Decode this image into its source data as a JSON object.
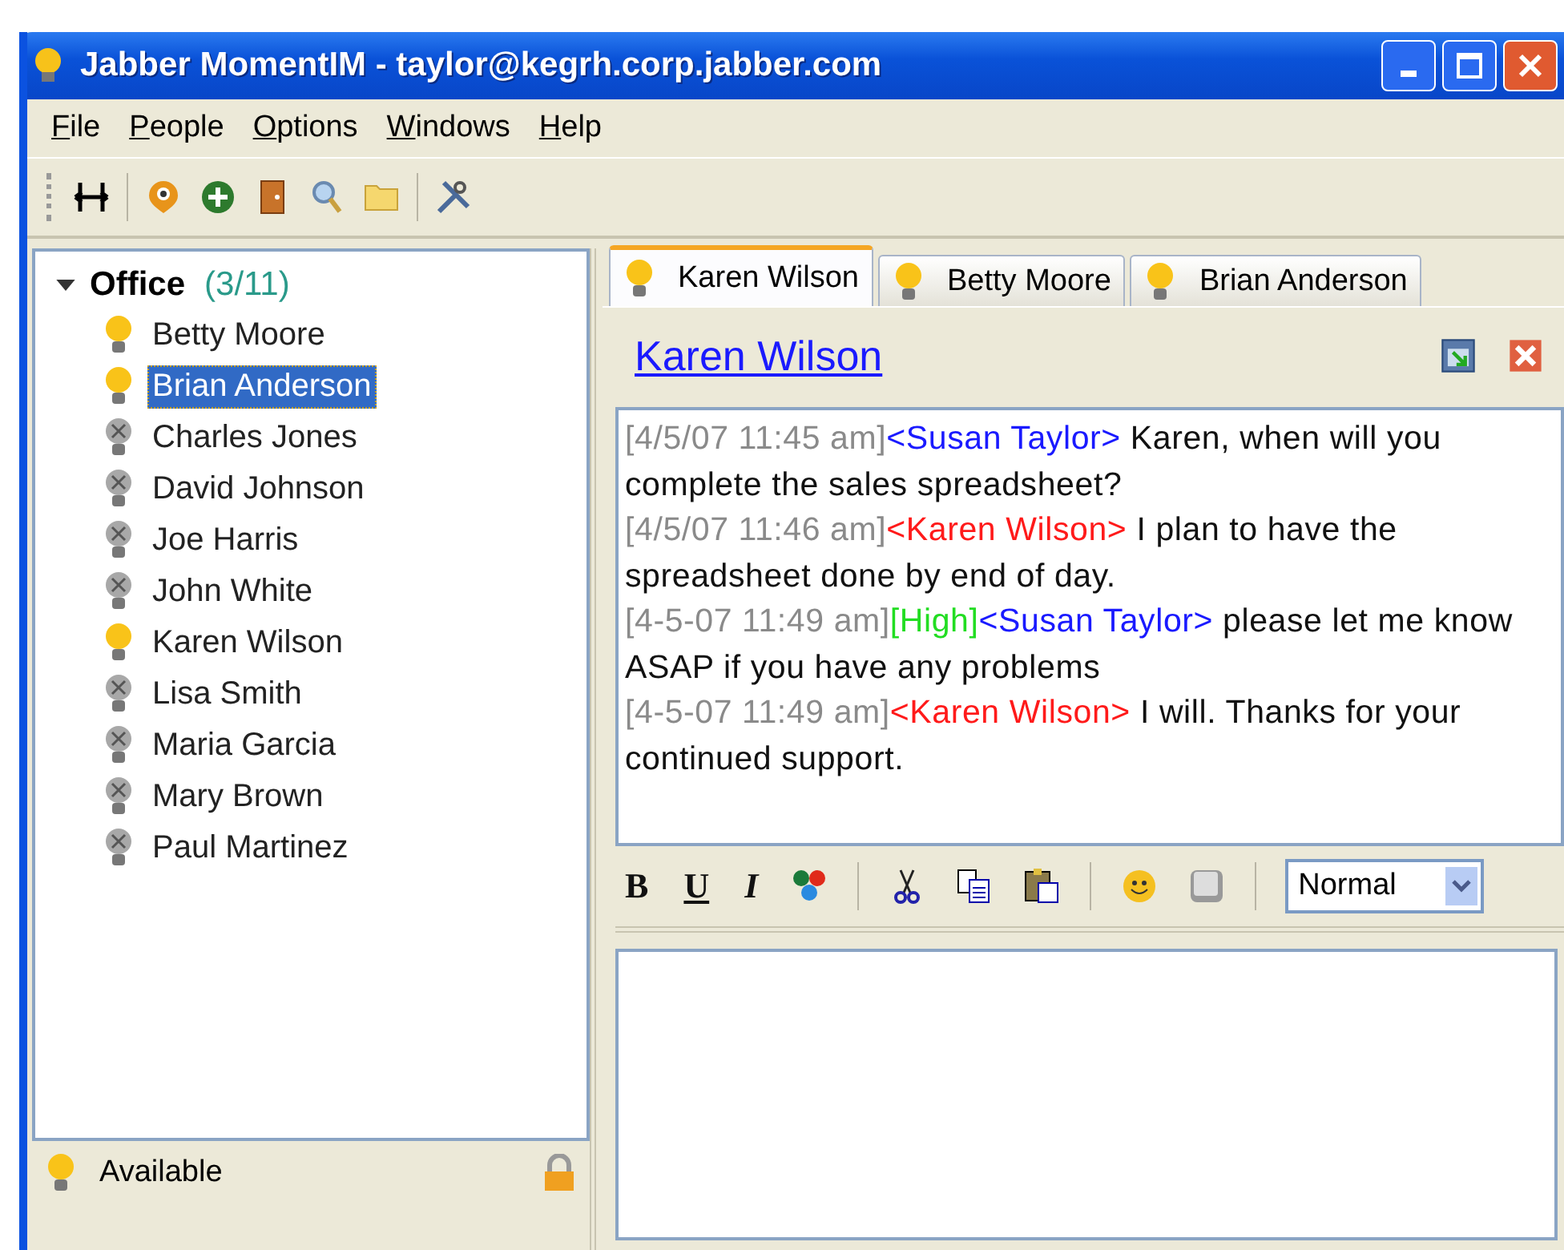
{
  "window": {
    "title": "Jabber MomentIM - taylor@kegrh.corp.jabber.com"
  },
  "menu": [
    "File",
    "People",
    "Options",
    "Windows",
    "Help"
  ],
  "roster": {
    "group": {
      "name": "Office",
      "count": "(3/11)",
      "expanded": true
    },
    "contacts": [
      {
        "name": "Betty Moore",
        "online": true,
        "selected": false
      },
      {
        "name": "Brian Anderson",
        "online": true,
        "selected": true
      },
      {
        "name": "Charles Jones",
        "online": false,
        "selected": false
      },
      {
        "name": "David Johnson",
        "online": false,
        "selected": false
      },
      {
        "name": "Joe Harris",
        "online": false,
        "selected": false
      },
      {
        "name": "John White",
        "online": false,
        "selected": false
      },
      {
        "name": "Karen Wilson",
        "online": true,
        "selected": false
      },
      {
        "name": "Lisa Smith",
        "online": false,
        "selected": false
      },
      {
        "name": "Maria Garcia",
        "online": false,
        "selected": false
      },
      {
        "name": "Mary Brown",
        "online": false,
        "selected": false
      },
      {
        "name": "Paul Martinez",
        "online": false,
        "selected": false
      }
    ]
  },
  "status": {
    "label": "Available"
  },
  "tabs": [
    {
      "label": "Karen Wilson",
      "selected": true
    },
    {
      "label": "Betty Moore",
      "selected": false
    },
    {
      "label": "Brian Anderson",
      "selected": false
    }
  ],
  "chat": {
    "contact": "Karen Wilson",
    "messages": [
      {
        "time": "[4/5/07 11:45 am]",
        "sender": "<Susan Taylor>",
        "color": "#1a1aff",
        "text": " Karen, when will you complete the sales spreadsheet?"
      },
      {
        "time": "[4/5/07 11:46 am]",
        "sender": "<Karen Wilson>",
        "color": "#ff1a1a",
        "text": " I plan to have the spreadsheet done by end of day."
      },
      {
        "time": "[4-5-07 11:49 am]",
        "tag": "[High]",
        "sender": "<Susan Taylor>",
        "color": "#1a1aff",
        "text": " please let me know ASAP if you have any problems"
      },
      {
        "time": "[4-5-07 11:49 am]",
        "sender": "<Karen Wilson>",
        "color": "#ff1a1a",
        "text": " I will. Thanks for your continued support."
      }
    ],
    "format": {
      "bold": "B",
      "underline": "U",
      "italic": "I",
      "style": "Normal"
    }
  }
}
